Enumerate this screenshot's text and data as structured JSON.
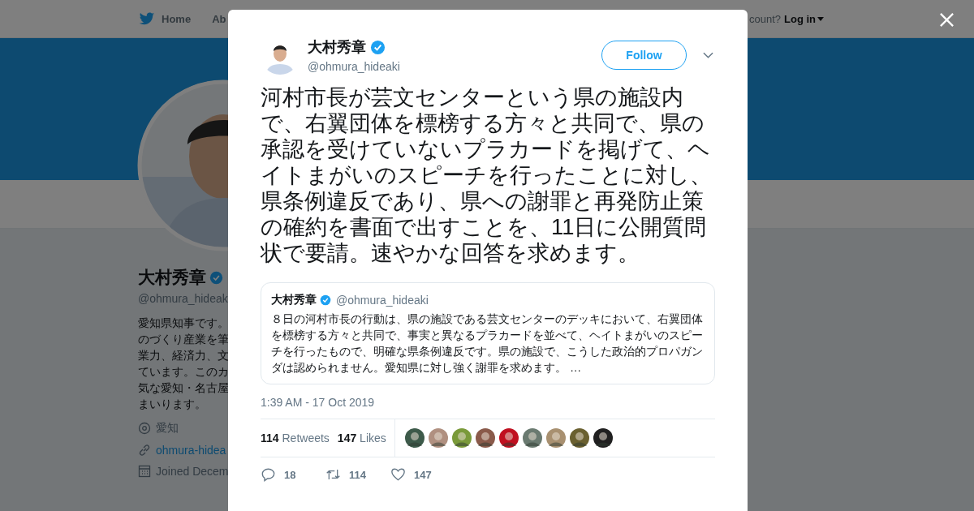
{
  "nav": {
    "items": [
      {
        "label": "Home"
      },
      {
        "label": "Ab"
      }
    ],
    "account_prompt": "count?",
    "login": "Log in"
  },
  "profile": {
    "name": "大村秀章",
    "verified": true,
    "handle": "@ohmura_hideak",
    "bio_lines": [
      "愛知県知事です。",
      "のづくり産業を筆",
      "業力、経済力、文",
      "ています。このカ",
      "気な愛知・名古屋",
      "まいります。"
    ],
    "location": "愛知",
    "link": "ohmura-hidea",
    "joined": "Joined Decem"
  },
  "modal": {
    "author": {
      "name": "大村秀章",
      "verified": true,
      "handle": "@ohmura_hideaki"
    },
    "follow_button": "Follow",
    "text": "河村市長が芸文センターという県の施設内で、右翼団体を標榜する方々と共同で、県の承認を受けていないプラカードを掲げて、ヘイトまがいのスピーチを行ったことに対し、県条例違反であり、県への謝罪と再発防止策の確約を書面で出すことを、11日に公開質問状で要請。速やかな回答を求めます。",
    "quoted": {
      "name": "大村秀章",
      "verified": true,
      "handle": "@ohmura_hideaki",
      "text": "８日の河村市長の行動は、県の施設である芸文センターのデッキにおいて、右翼団体を標榜する方々と共同で、事実と異なるプラカードを並べて、ヘイトまがいのスピーチを行ったもので、明確な県条例違反です。県の施設で、こうした政治的プロパガンダは認められません。愛知県に対し強く謝罪を求めます。 …"
    },
    "timestamp": "1:39 AM - 17 Oct 2019",
    "stats": [
      {
        "count": "114",
        "label": "Retweets"
      },
      {
        "count": "147",
        "label": "Likes"
      }
    ],
    "likers": [
      {
        "color": "#3d5a4a"
      },
      {
        "color": "#b09080"
      },
      {
        "color": "#7a9a3a"
      },
      {
        "color": "#8a5a4a"
      },
      {
        "color": "#c01020"
      },
      {
        "color": "#6a7a70"
      },
      {
        "color": "#a89070"
      },
      {
        "color": "#6a6030"
      },
      {
        "color": "#202020"
      }
    ],
    "actions": [
      {
        "kind": "reply",
        "count": "18"
      },
      {
        "kind": "retweet",
        "count": "114"
      },
      {
        "kind": "like",
        "count": "147"
      }
    ]
  }
}
